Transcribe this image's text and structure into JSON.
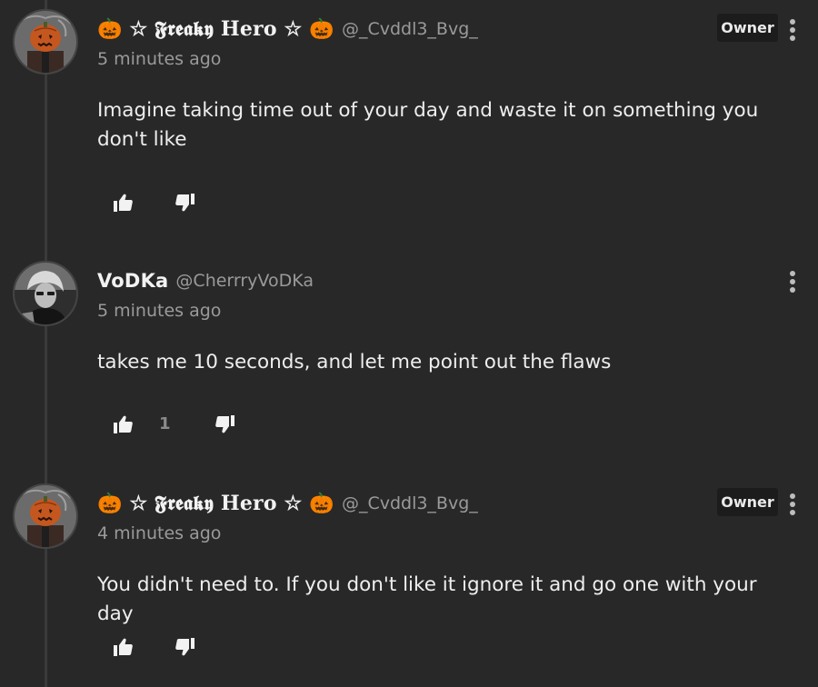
{
  "comments": [
    {
      "author": "🎃 ☆ 𝕱𝖗𝖊𝖆𝖐𝖞 Hero ☆ 🎃",
      "handle": "@_Cvddl3_Bvg_",
      "time": "5 minutes ago",
      "badge": "Owner",
      "text": "Imagine taking time out of your day and waste it on something you don't like",
      "likes": "",
      "avatar": "pumpkin-head-avatar"
    },
    {
      "author": "VoDKa",
      "handle": "@CherrryVoDKa",
      "time": "5 minutes ago",
      "badge": "",
      "text": "takes me 10 seconds, and let me point out the flaws",
      "likes": "1",
      "avatar": "grayscale-photo-avatar"
    },
    {
      "author": "🎃 ☆ 𝕱𝖗𝖊𝖆𝖐𝖞 Hero ☆ 🎃",
      "handle": "@_Cvddl3_Bvg_",
      "time": "4 minutes ago",
      "badge": "Owner",
      "text": "You didn't need to. If you don't like it ignore it and go one with your day",
      "likes": "",
      "avatar": "pumpkin-head-avatar"
    }
  ],
  "colors": {
    "background": "#282828",
    "text": "#eeeeee",
    "muted": "#9a9a9a",
    "badge_bg": "#1c1c1c"
  }
}
